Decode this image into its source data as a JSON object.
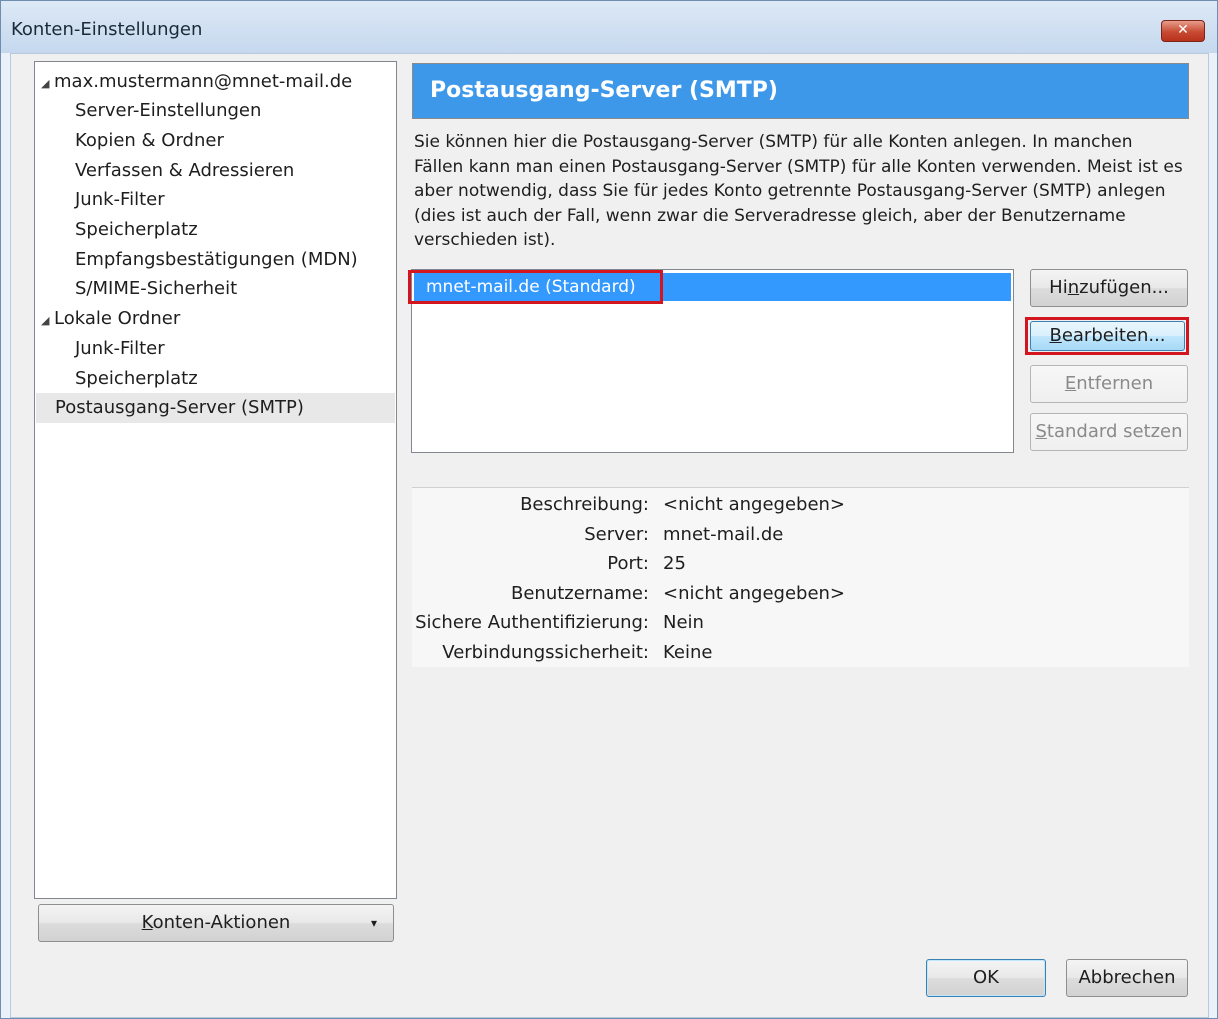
{
  "window": {
    "title": "Konten-Einstellungen",
    "close_label": "✕"
  },
  "tree": {
    "account": "max.mustermann@mnet-mail.de",
    "account_items": [
      "Server-Einstellungen",
      "Kopien & Ordner",
      "Verfassen & Adressieren",
      "Junk-Filter",
      "Speicherplatz",
      "Empfangsbestätigungen (MDN)",
      "S/MIME-Sicherheit"
    ],
    "local_folder": "Lokale Ordner",
    "local_items": [
      "Junk-Filter",
      "Speicherplatz"
    ],
    "smtp_item": "Postausgang-Server (SMTP)",
    "expanded_glyph": "◢"
  },
  "account_actions": {
    "label_accel": "K",
    "label_rest": "onten-Aktionen",
    "arrow": "▾"
  },
  "main": {
    "title": "Postausgang-Server (SMTP)",
    "description": "Sie können hier die Postausgang-Server (SMTP) für alle Konten anlegen. In manchen Fällen kann man einen Postausgang-Server (SMTP) für alle Konten verwenden. Meist ist es aber notwendig, dass Sie für jedes Konto getrennte Postausgang-Server (SMTP) anlegen (dies ist auch der Fall, wenn zwar die Serveradresse gleich, aber der Benutzername verschieden ist)."
  },
  "server_list": {
    "selected": "mnet-mail.de (Standard)"
  },
  "buttons": {
    "add": {
      "pre": "Hi",
      "accel": "n",
      "post": "zufügen..."
    },
    "edit": {
      "pre": "",
      "accel": "B",
      "post": "earbeiten..."
    },
    "remove": {
      "pre": "",
      "accel": "E",
      "post": "ntfernen"
    },
    "set_default": {
      "pre": "",
      "accel": "S",
      "post": "tandard setzen"
    },
    "ok": "OK",
    "cancel": "Abbrechen"
  },
  "details": [
    {
      "label": "Beschreibung:",
      "value": "<nicht angegeben>"
    },
    {
      "label": "Server:",
      "value": "mnet-mail.de"
    },
    {
      "label": "Port:",
      "value": "25"
    },
    {
      "label": "Benutzername:",
      "value": "<nicht angegeben>"
    },
    {
      "label": "Sichere Authentifizierung:",
      "value": "Nein"
    },
    {
      "label": "Verbindungssicherheit:",
      "value": "Keine"
    }
  ],
  "colors": {
    "header": "#3e98ea",
    "selection": "#3399ff",
    "highlight_box": "#d2151f"
  }
}
